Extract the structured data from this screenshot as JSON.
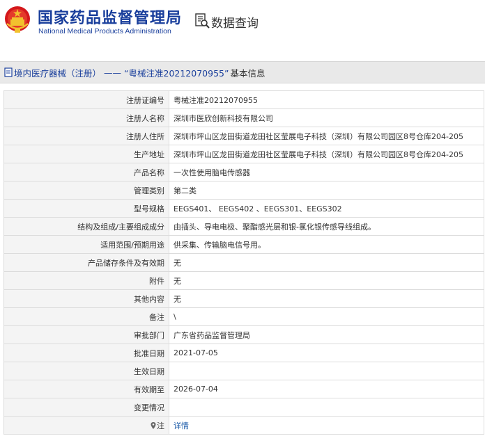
{
  "header": {
    "site_name_cn": "国家药品监督管理局",
    "site_name_en": "National Medical Products Administration",
    "query_label": "数据查询"
  },
  "title_bar": {
    "category": "境内医疗器械（注册）",
    "separator": "——",
    "reg_no_quoted": "“粤械注准20212070955”",
    "suffix": "基本信息"
  },
  "rows": [
    {
      "label": "注册证编号",
      "value": "粤械注准20212070955"
    },
    {
      "label": "注册人名称",
      "value": "深圳市医欣创新科技有限公司"
    },
    {
      "label": "注册人住所",
      "value": "深圳市坪山区龙田街道龙田社区莹展电子科技（深圳）有限公司园区8号仓库204-205"
    },
    {
      "label": "生产地址",
      "value": "深圳市坪山区龙田街道龙田社区莹展电子科技（深圳）有限公司园区8号仓库204-205"
    },
    {
      "label": "产品名称",
      "value": "一次性使用脑电传感器"
    },
    {
      "label": "管理类别",
      "value": "第二类"
    },
    {
      "label": "型号规格",
      "value": "EEGS401、 EEGS402 、EEGS301、EEGS302"
    },
    {
      "label": "结构及组成/主要组成成分",
      "value": "由插头、导电电极、聚酯感光层和银-氯化银传感导线组成。"
    },
    {
      "label": "适用范围/预期用途",
      "value": "供采集、传输脑电信号用。"
    },
    {
      "label": "产品储存条件及有效期",
      "value": "无"
    },
    {
      "label": "附件",
      "value": "无"
    },
    {
      "label": "其他内容",
      "value": "无"
    },
    {
      "label": "备注",
      "value": "\\"
    },
    {
      "label": "审批部门",
      "value": "广东省药品监督管理局"
    },
    {
      "label": "批准日期",
      "value": "2021-07-05"
    },
    {
      "label": "生效日期",
      "value": ""
    },
    {
      "label": "有效期至",
      "value": "2026-07-04"
    },
    {
      "label": "变更情况",
      "value": ""
    },
    {
      "label": "注",
      "value": "详情"
    }
  ],
  "colors": {
    "brand_blue": "#1a3f9c",
    "link_blue": "#1a5aa8",
    "emblem_red": "#d4181c",
    "emblem_gold": "#f2c12e"
  },
  "icons": [
    "national-emblem-icon",
    "query-document-icon",
    "document-icon",
    "location-pin-icon"
  ]
}
